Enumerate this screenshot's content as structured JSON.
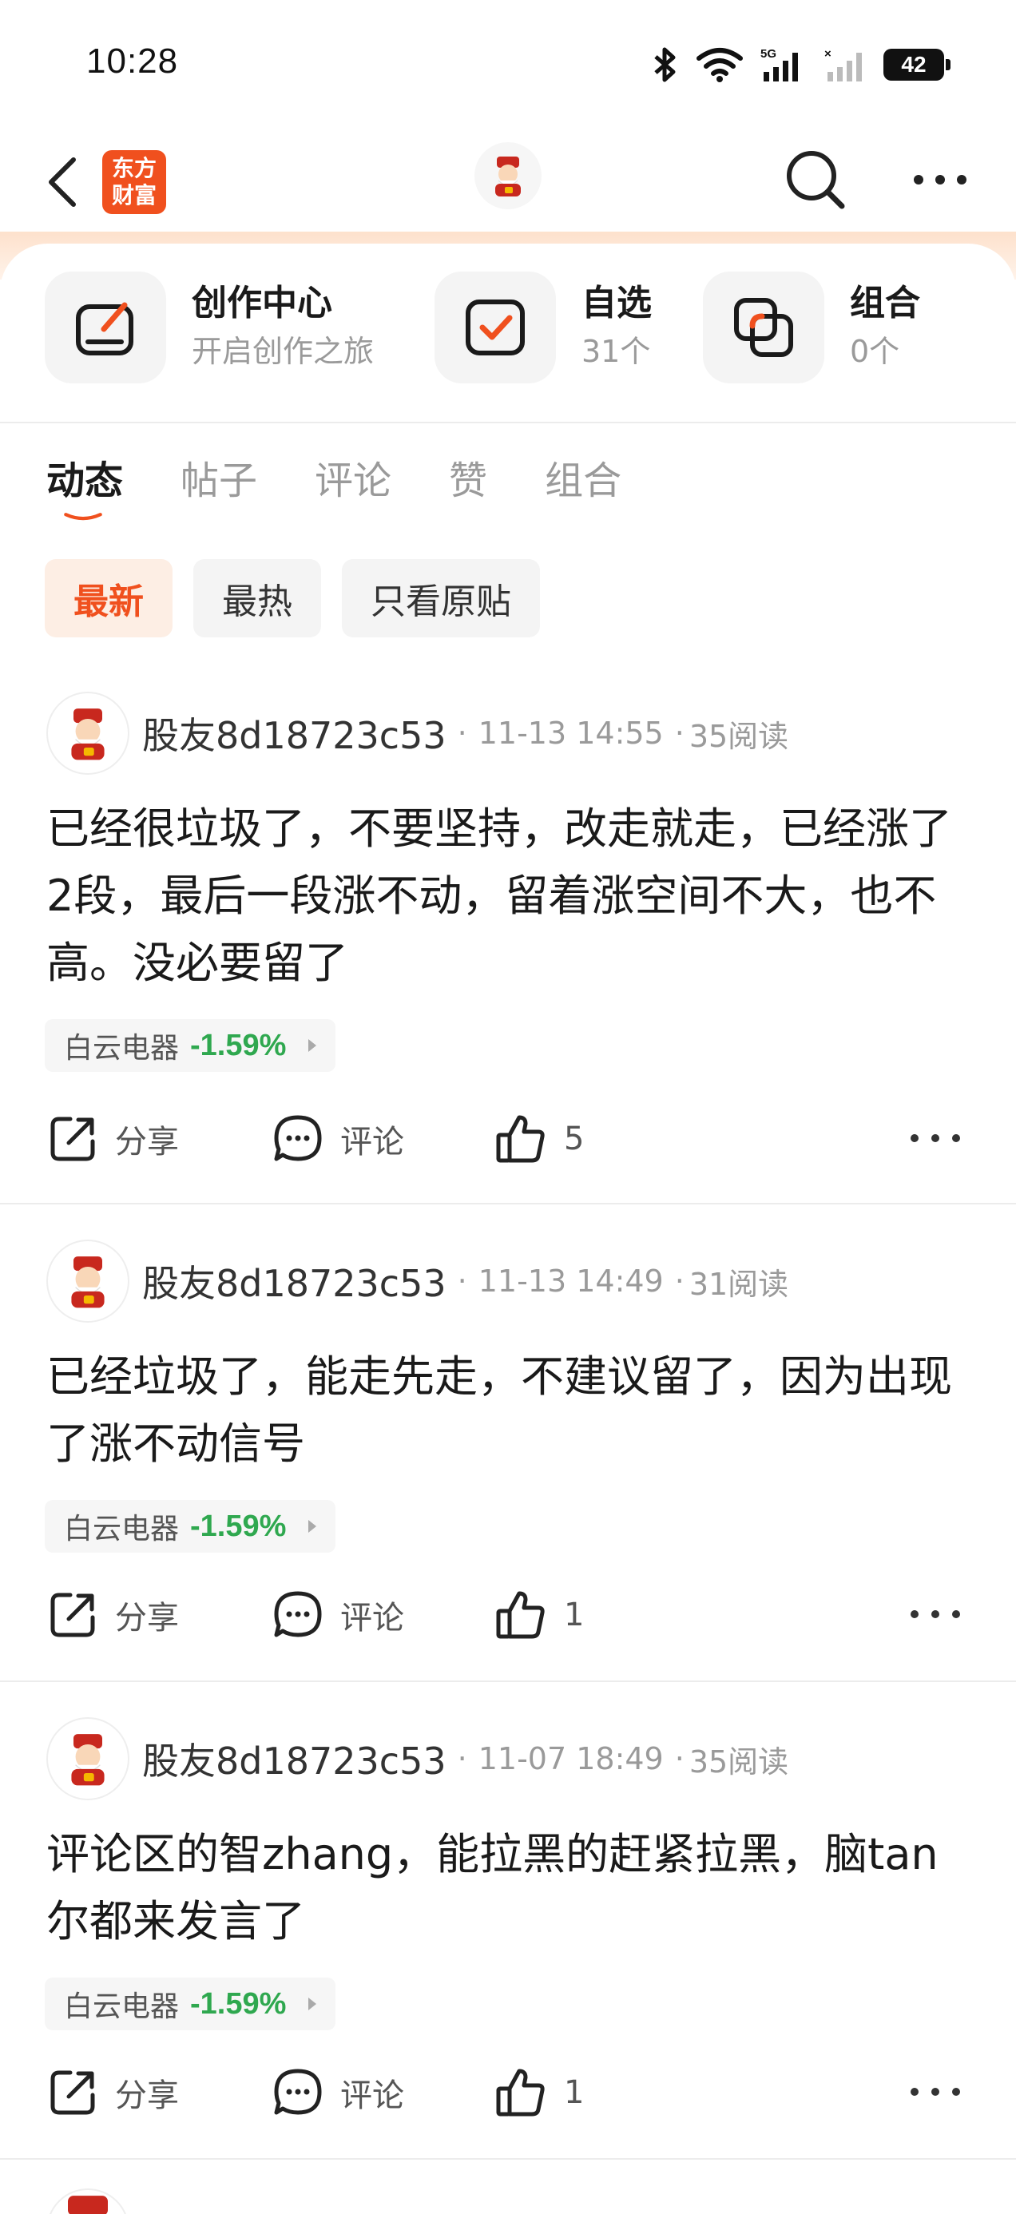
{
  "status_bar": {
    "time": "10:28",
    "network": "5G",
    "battery": "42"
  },
  "header": {
    "brand_line1": "东方",
    "brand_line2": "财富"
  },
  "quick_panel": [
    {
      "title": "创作中心",
      "sub": "开启创作之旅",
      "icon": "edit-icon"
    },
    {
      "title": "自选",
      "sub": "31个",
      "icon": "checkbox-icon"
    },
    {
      "title": "组合",
      "sub": "0个",
      "icon": "portfolio-icon"
    }
  ],
  "tabs": [
    {
      "label": "动态",
      "active": true
    },
    {
      "label": "帖子",
      "active": false
    },
    {
      "label": "评论",
      "active": false
    },
    {
      "label": "赞",
      "active": false
    },
    {
      "label": "组合",
      "active": false
    }
  ],
  "filters": [
    {
      "label": "最新",
      "active": true
    },
    {
      "label": "最热",
      "active": false
    },
    {
      "label": "只看原贴",
      "active": false
    }
  ],
  "posts": [
    {
      "user": "股友8d18723c53",
      "time": "11-13 14:55",
      "reads": "35阅读",
      "content": "已经很垃圾了，不要坚持，改走就走，已经涨了2段，最后一段涨不动，留着涨空间不大，也不高。没必要留了",
      "stock": "白云电器",
      "change": "-1.59%",
      "share_label": "分享",
      "comment_label": "评论",
      "likes": "5"
    },
    {
      "user": "股友8d18723c53",
      "time": "11-13 14:49",
      "reads": "31阅读",
      "content": "已经垃圾了，能走先走，不建议留了，因为出现了涨不动信号",
      "stock": "白云电器",
      "change": "-1.59%",
      "share_label": "分享",
      "comment_label": "评论",
      "likes": "1"
    },
    {
      "user": "股友8d18723c53",
      "time": "11-07 18:49",
      "reads": "35阅读",
      "content": "评论区的智zhang，能拉黑的赶紧拉黑，脑tan尔都来发言了",
      "stock": "白云电器",
      "change": "-1.59%",
      "share_label": "分享",
      "comment_label": "评论",
      "likes": "1"
    }
  ],
  "colors": {
    "accent": "#f0501e",
    "down": "#2fa84f"
  }
}
